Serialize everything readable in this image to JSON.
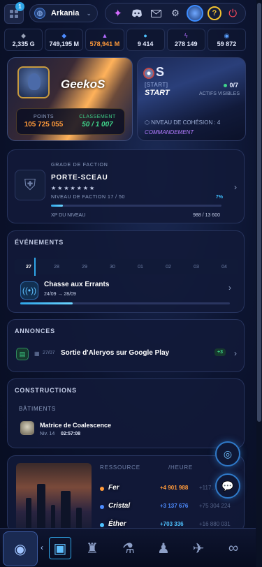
{
  "topbar": {
    "notification_count": "1",
    "server_name": "Arkania"
  },
  "resources": [
    {
      "icon": "ore-icon",
      "value": "2,335 G",
      "color": "#9aa3b8"
    },
    {
      "icon": "crystal-icon",
      "value": "749,195 M",
      "color": "#4d8cff"
    },
    {
      "icon": "ether-icon",
      "value": "578,941 M",
      "color": "#ff9a3a"
    },
    {
      "icon": "gem-icon",
      "value": "9 414",
      "color": "#4fc3ff"
    },
    {
      "icon": "energy-icon",
      "value": "278 149",
      "color": "#b26bff"
    },
    {
      "icon": "orb-icon",
      "value": "59 872",
      "color": "#5aa0ff"
    }
  ],
  "profile": {
    "name": "GeekoS",
    "points_label": "POINTS",
    "points_value": "105 725 055",
    "rank_label": "CLASSEMENT",
    "rank_value": "50 / 1 007"
  },
  "alliance": {
    "letter": "S",
    "tag": "[START]",
    "name": "START",
    "active_count": "0/7",
    "active_label": "ACTIFS VISIBLES",
    "cohesion": "NIVEAU DE COHÉSION : 4",
    "command": "COMMANDEMENT"
  },
  "faction": {
    "grade_label": "GRADE DE FACTION",
    "name": "PORTE-SCEAU",
    "stars": "★★★★★★★",
    "level_text": "NIVEAU DE FACTION 17 / 50",
    "percent_text": "7%",
    "progress": 0.07,
    "xp_label": "XP DU NIVEAU",
    "xp_value": "988 / 13 600"
  },
  "events": {
    "title": "ÉVÉNEMENTS",
    "days": [
      "27",
      "28",
      "29",
      "30",
      "01",
      "02",
      "03",
      "04"
    ],
    "active_day": "27",
    "item": {
      "title": "Chasse aux Errants",
      "dates": "24/09 → 28/09",
      "progress": 0.25
    }
  },
  "announces": {
    "title": "ANNONCES",
    "date": "27/07",
    "text": "Sortie d'Aleryos sur Google Play",
    "badge": "+3"
  },
  "constructions": {
    "title": "CONSTRUCTIONS",
    "sub_title": "BÂTIMENTS",
    "building": {
      "name": "Matrice de Coalescence",
      "level": "Niv. 14",
      "time": "02:57:08"
    }
  },
  "production": {
    "head_resource": "RESSOURCE",
    "head_hour": "/HEURE",
    "rows": [
      {
        "name": "Fer",
        "rate": "+4 901 988",
        "stock": "+117…",
        "color": "#ff9a3a"
      },
      {
        "name": "Cristal",
        "rate": "+3 137 676",
        "stock": "+75 304 224",
        "color": "#4d8cff"
      },
      {
        "name": "Éther",
        "rate": "+703 336",
        "stock": "+16 880 031",
        "color": "#4fc3ff"
      }
    ]
  }
}
